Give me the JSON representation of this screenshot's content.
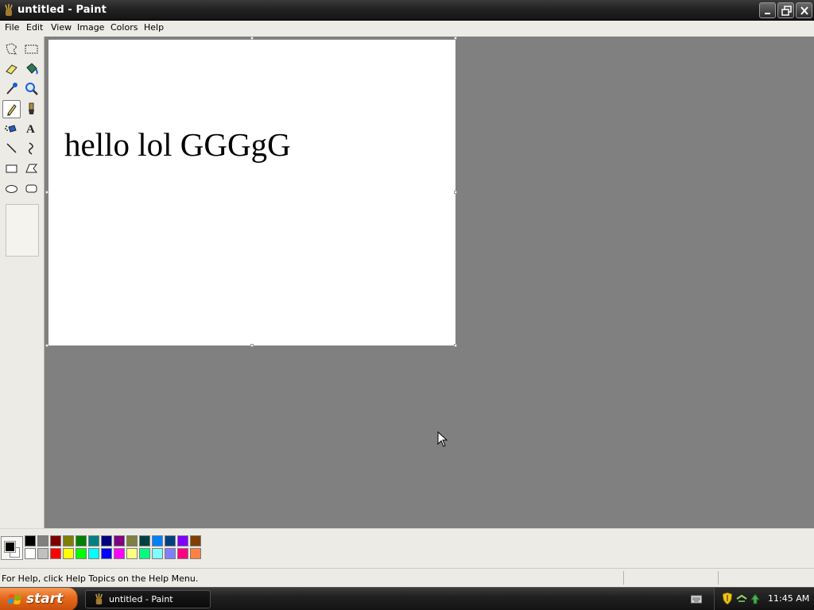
{
  "window": {
    "title": "untitled - Paint",
    "buttons": {
      "minimize": "minimize",
      "maximize": "restore",
      "close": "close"
    }
  },
  "menu": {
    "items": [
      "File",
      "Edit",
      "View",
      "Image",
      "Colors",
      "Help"
    ]
  },
  "toolbox": {
    "tools": [
      "free-form-select-icon",
      "select-icon",
      "eraser-icon",
      "fill-icon",
      "pick-color-icon",
      "magnifier-icon",
      "pencil-icon",
      "brush-icon",
      "airbrush-icon",
      "text-icon",
      "line-icon",
      "curve-icon",
      "rectangle-icon",
      "polygon-icon",
      "ellipse-icon",
      "rounded-rectangle-icon"
    ],
    "selected_tool": "pencil-icon"
  },
  "canvas": {
    "text": "hello lol GGGgG",
    "background": "#ffffff"
  },
  "palette": {
    "foreground": "#000000",
    "background": "#ffffff",
    "row1": [
      "#000000",
      "#808080",
      "#800000",
      "#808000",
      "#008000",
      "#008080",
      "#000080",
      "#800080",
      "#808040",
      "#004040",
      "#0080ff",
      "#004080",
      "#8000ff",
      "#804000"
    ],
    "row2": [
      "#ffffff",
      "#c0c0c0",
      "#ff0000",
      "#ffff00",
      "#00ff00",
      "#00ffff",
      "#0000ff",
      "#ff00ff",
      "#ffff80",
      "#00ff80",
      "#80ffff",
      "#8080ff",
      "#ff0080",
      "#ff8040"
    ]
  },
  "statusbar": {
    "help_text": "For Help, click Help Topics on the Help Menu."
  },
  "taskbar": {
    "start_label": "start",
    "tasks": [
      {
        "label": "untitled - Paint"
      }
    ],
    "clock": "11:45 AM"
  },
  "colors": {
    "workspace": "#808080",
    "chrome": "#ecebe6",
    "start_button": "#e86b1c"
  }
}
